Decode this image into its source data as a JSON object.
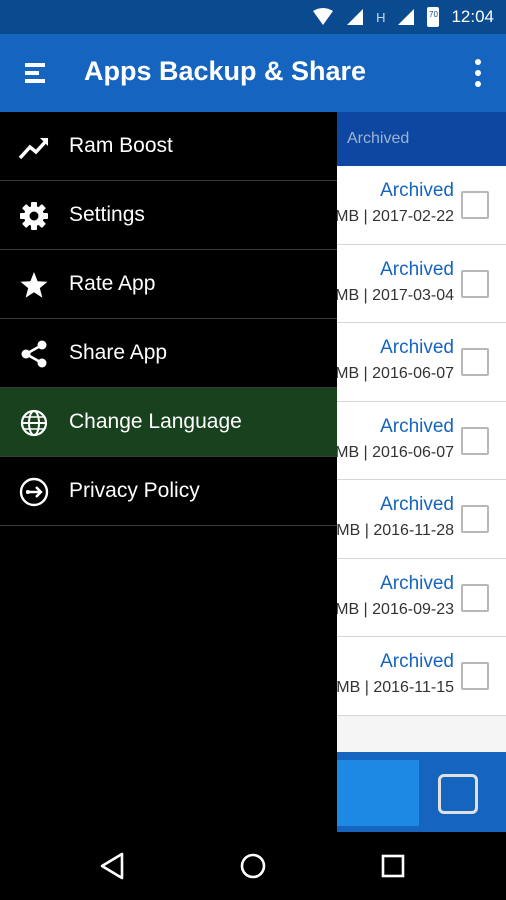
{
  "status_bar": {
    "time": "12:04",
    "battery": "70",
    "network_label": "H"
  },
  "app_bar": {
    "title": "Apps Backup & Share"
  },
  "tab_bar": {
    "tab_label": "Archived"
  },
  "list": {
    "rows": [
      {
        "status": "Archived",
        "meta": "MB | 2017-02-22"
      },
      {
        "status": "Archived",
        "meta": "MB | 2017-03-04"
      },
      {
        "status": "Archived",
        "meta": "MB | 2016-06-07"
      },
      {
        "status": "Archived",
        "meta": "MB | 2016-06-07"
      },
      {
        "status": "Archived",
        "meta": "MB | 2016-11-28"
      },
      {
        "status": "Archived",
        "meta": "MB | 2016-09-23"
      },
      {
        "status": "Archived",
        "meta": "MB | 2016-11-15"
      }
    ]
  },
  "drawer": {
    "items": [
      {
        "label": "Ram Boost",
        "icon": "trending-up-icon"
      },
      {
        "label": "Settings",
        "icon": "gear-icon"
      },
      {
        "label": "Rate App",
        "icon": "star-icon"
      },
      {
        "label": "Share App",
        "icon": "share-icon"
      },
      {
        "label": "Change Language",
        "icon": "globe-icon",
        "active": true
      },
      {
        "label": "Privacy Policy",
        "icon": "privacy-icon"
      }
    ]
  },
  "colors": {
    "primary": "#1565c0",
    "primary_dark": "#0d47a1",
    "active_item": "#18421e"
  }
}
